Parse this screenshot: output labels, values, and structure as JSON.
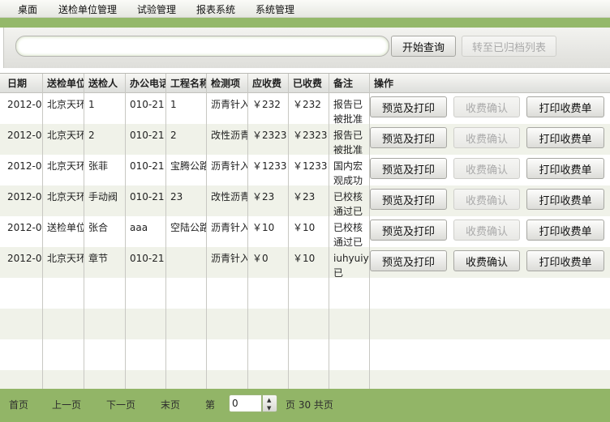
{
  "menu": [
    "桌面",
    "送检单位管理",
    "试验管理",
    "报表系统",
    "系统管理"
  ],
  "search": {
    "value": "",
    "placeholder": "",
    "query_label": "开始查询",
    "archive_label": "转至已归档列表"
  },
  "table": {
    "headers": [
      "日期",
      "送检单位",
      "送检人",
      "办公电话",
      "工程名称",
      "检测项",
      "应收费",
      "已收费",
      "备注",
      "操作"
    ],
    "rows": [
      {
        "date": "2012-0",
        "unit": "北京天环",
        "person": "1",
        "phone": "010-21",
        "project": "1",
        "item": "沥青针入",
        "due": "￥232",
        "paid": "￥232",
        "note": "报告已被批准",
        "confirm_enabled": false
      },
      {
        "date": "2012-0",
        "unit": "北京天环",
        "person": "2",
        "phone": "010-21",
        "project": "2",
        "item": "改性沥青",
        "due": "￥2323",
        "paid": "￥2323",
        "note": "报告已被批准",
        "confirm_enabled": false
      },
      {
        "date": "2012-0",
        "unit": "北京天环",
        "person": "张菲",
        "phone": "010-21",
        "project": "宝腾公路",
        "item": "沥青针入",
        "due": "￥1233",
        "paid": "￥1233",
        "note": "国内宏观成功",
        "confirm_enabled": false
      },
      {
        "date": "2012-0",
        "unit": "北京天环",
        "person": "手动阀",
        "phone": "010-21",
        "project": "23",
        "item": "改性沥青",
        "due": "￥23",
        "paid": "￥23",
        "note": "已校核通过已",
        "confirm_enabled": false
      },
      {
        "date": "2012-0",
        "unit": "送检单位",
        "person": "张合",
        "phone": "aaa",
        "project": "空陆公路",
        "item": "沥青针入",
        "due": "￥10",
        "paid": "￥10",
        "note": "已校核通过已",
        "confirm_enabled": false
      },
      {
        "date": "2012-0",
        "unit": "北京天环",
        "person": "章节",
        "phone": "010-21",
        "project": "",
        "item": "沥青针入",
        "due": "￥0",
        "paid": "￥10",
        "note": "iuhyuiyuiy已",
        "confirm_enabled": true
      }
    ],
    "actions": {
      "preview": "预览及打印",
      "confirm": "收费确认",
      "print": "打印收费单"
    }
  },
  "pager": {
    "first": "首页",
    "prev": "上一页",
    "next": "下一页",
    "last": "末页",
    "page_prefix": "第",
    "page_value": "0",
    "page_suffix": "页 30 共页"
  }
}
